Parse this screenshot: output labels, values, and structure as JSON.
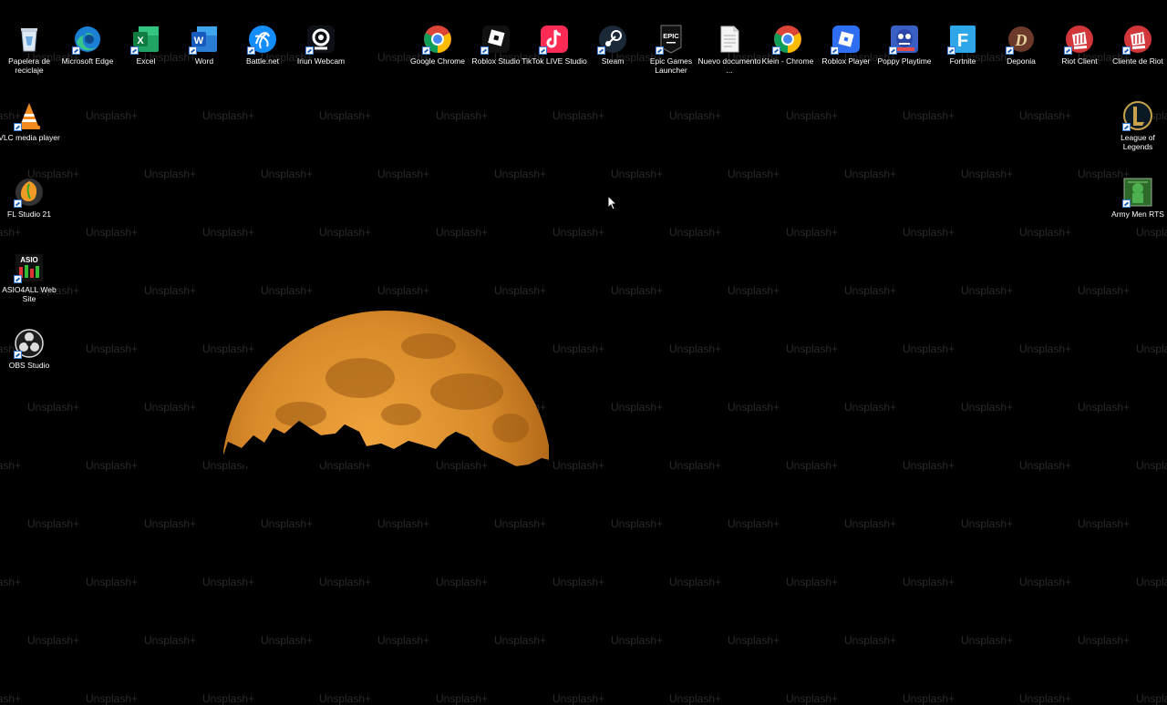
{
  "desktop": {
    "watermark_text": "Unsplash+",
    "wallpaper": {
      "colors": {
        "moon": "#d88a2a",
        "sky": "#000000"
      }
    },
    "icons": [
      {
        "label": "Papelera de reciclaje",
        "icon": "recycle-bin-icon"
      },
      {
        "label": "Microsoft Edge",
        "icon": "edge-icon"
      },
      {
        "label": "Excel",
        "icon": "excel-icon"
      },
      {
        "label": "Word",
        "icon": "word-icon"
      },
      {
        "label": "Battle.net",
        "icon": "battlenet-icon"
      },
      {
        "label": "Iriun Webcam",
        "icon": "webcam-icon"
      },
      {
        "label": "Google Chrome",
        "icon": "chrome-icon"
      },
      {
        "label": "Roblox Studio",
        "icon": "roblox-studio-icon"
      },
      {
        "label": "TikTok LIVE Studio",
        "icon": "tiktok-icon"
      },
      {
        "label": "Steam",
        "icon": "steam-icon"
      },
      {
        "label": "Epic Games Launcher",
        "icon": "epic-games-icon"
      },
      {
        "label": "Nuevo documento ...",
        "icon": "document-icon"
      },
      {
        "label": "Klein - Chrome",
        "icon": "chrome-icon"
      },
      {
        "label": "Roblox Player",
        "icon": "roblox-player-icon"
      },
      {
        "label": "Poppy Playtime",
        "icon": "poppy-playtime-icon"
      },
      {
        "label": "Fortnite",
        "icon": "fortnite-icon"
      },
      {
        "label": "Deponia",
        "icon": "deponia-icon"
      },
      {
        "label": "Riot Client",
        "icon": "riot-icon"
      },
      {
        "label": "Cliente de Riot",
        "icon": "riot-icon"
      },
      {
        "label": "VLC media player",
        "icon": "vlc-icon"
      },
      {
        "label": "League of Legends",
        "icon": "league-icon"
      },
      {
        "label": "FL Studio 21",
        "icon": "fl-studio-icon"
      },
      {
        "label": "Army Men RTS",
        "icon": "army-men-icon"
      },
      {
        "label": "ASIO4ALL Web Site",
        "icon": "asio-icon"
      },
      {
        "label": "OBS Studio",
        "icon": "obs-icon"
      }
    ],
    "glyphs": {
      "excel": "X",
      "word": "W",
      "epic": "EPIC",
      "fortnite": "F",
      "asio": "ASIO",
      "deponia": "D"
    }
  }
}
